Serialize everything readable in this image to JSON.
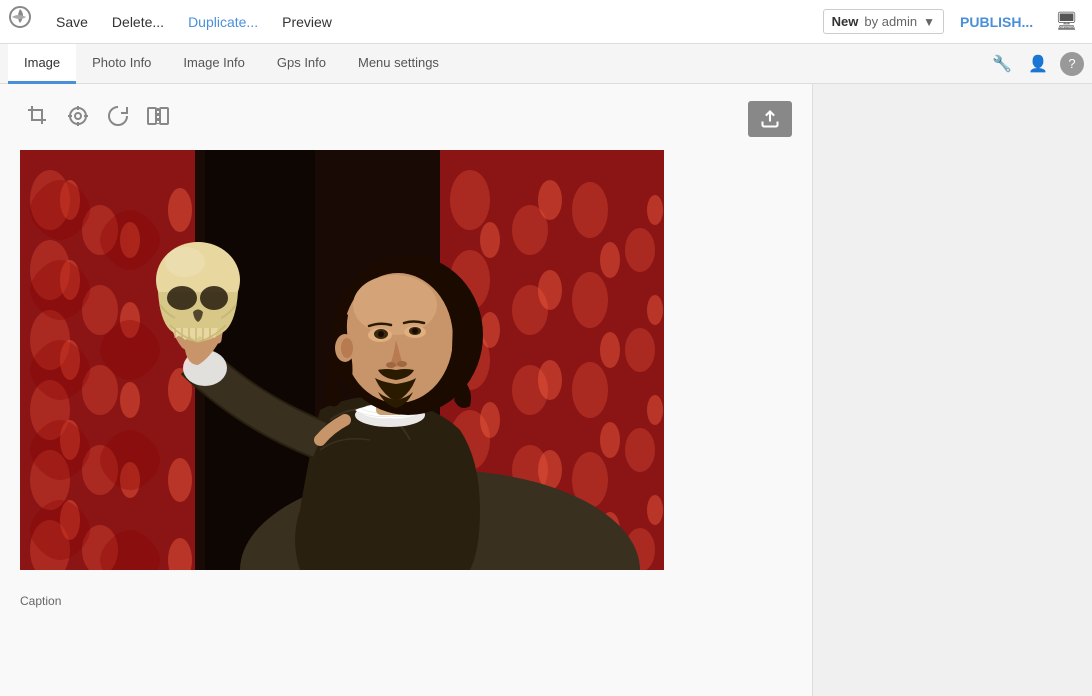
{
  "app": {
    "logo_alt": "App Logo"
  },
  "toolbar": {
    "save_label": "Save",
    "delete_label": "Delete...",
    "duplicate_label": "Duplicate...",
    "preview_label": "Preview",
    "status_new": "New",
    "status_by": "by admin",
    "publish_label": "PUBLISH...",
    "monitor_icon": "🖥"
  },
  "tabs": [
    {
      "id": "image",
      "label": "Image",
      "active": true
    },
    {
      "id": "photo-info",
      "label": "Photo Info",
      "active": false
    },
    {
      "id": "image-info",
      "label": "Image Info",
      "active": false
    },
    {
      "id": "gps-info",
      "label": "Gps Info",
      "active": false
    },
    {
      "id": "menu-settings",
      "label": "Menu settings",
      "active": false
    }
  ],
  "image_tools": {
    "crop_icon": "✂",
    "focus_icon": "◎",
    "rotate_icon": "↻",
    "flip_icon": "⧈",
    "upload_icon": "⬆"
  },
  "caption": {
    "label": "Caption"
  },
  "status_colors": {
    "accent": "#4a90d9",
    "toolbar_bg": "#ffffff",
    "tabs_bg": "#f5f5f5"
  }
}
